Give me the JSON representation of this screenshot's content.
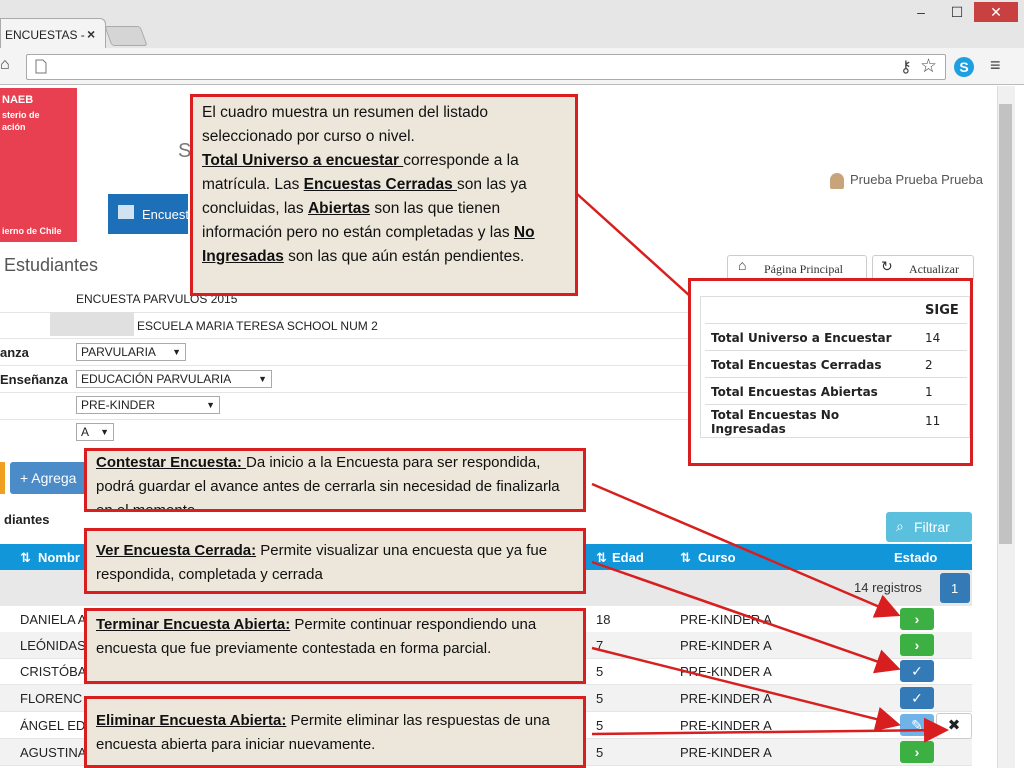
{
  "browser": {
    "tab_title": "ENCUESTAS -",
    "tab_close": "×",
    "window_controls": [
      "–",
      "☐",
      "✕"
    ]
  },
  "header": {
    "logo_lines": [
      "NAEB",
      "sterio de",
      "ación",
      "ierno de Chile"
    ],
    "partial_title": "S",
    "user_name": "Prueba Prueba Prueba",
    "menu_button": "Encuest"
  },
  "page": {
    "title": "Estudiantes",
    "btn_home": "Página Principal",
    "btn_refresh": "Actualizar"
  },
  "form": {
    "survey_name": "ENCUESTA PARVULOS 2015",
    "school_name": "ESCUELA MARIA TERESA SCHOOL NUM 2",
    "label_ensenanza": "anza",
    "label_tipo_ensenanza": "Enseñanza",
    "select_ensenanza": "PARVULARIA",
    "select_tipo": "EDUCACIÓN PARVULARIA",
    "select_grado": "PRE-KINDER",
    "select_letra": "A"
  },
  "actions": {
    "agregar": "+ Agrega",
    "estudiantes_label": "diantes",
    "filtrar": "Filtrar"
  },
  "summary": {
    "header": "SIGE",
    "rows": [
      {
        "label": "Total Universo a Encuestar",
        "value": "14"
      },
      {
        "label": "Total Encuestas Cerradas",
        "value": "2"
      },
      {
        "label": "Total Encuestas Abiertas",
        "value": "1"
      },
      {
        "label": "Total Encuestas No Ingresadas",
        "value": "11"
      }
    ]
  },
  "table": {
    "columns": {
      "nombre": "Nombr",
      "edad": "Edad",
      "curso": "Curso",
      "estado": "Estado"
    },
    "records_text": "14 registros",
    "page": "1",
    "rows": [
      {
        "nombre": "DANIELA A",
        "edad": "18",
        "curso": "PRE-KINDER A",
        "estado": "green"
      },
      {
        "nombre": "LEÓNIDAS",
        "edad": "7",
        "curso": "PRE-KINDER A",
        "estado": "green"
      },
      {
        "nombre": "CRISTÓBA",
        "edad": "5",
        "curso": "PRE-KINDER A",
        "estado": "blue"
      },
      {
        "nombre": "FLORENC",
        "edad": "5",
        "curso": "PRE-KINDER A",
        "estado": "blue"
      },
      {
        "nombre": "ÁNGEL ED",
        "edad": "5",
        "curso": "PRE-KINDER A",
        "estado": "lblue"
      },
      {
        "nombre": "AGUSTINA",
        "edad": "5",
        "curso": "PRE-KINDER A",
        "estado": "green"
      }
    ],
    "delete_icon": "✖"
  },
  "annotations": {
    "top": {
      "line1": "El cuadro muestra un resumen del listado seleccionado por curso o nivel.",
      "k1": "Total Universo a encuestar ",
      "t1": "corresponde a la matrícula. Las ",
      "k2": "Encuestas Cerradas ",
      "t2": "son las ya concluidas, las ",
      "k3": "Abiertas",
      "t3": " son las que tienen información pero no están completadas y las ",
      "k4": "No Ingresadas",
      "t4": " son las que aún están pendientes."
    },
    "contestar": {
      "key": "Contestar Encuesta: ",
      "text": " Da inicio a la Encuesta para ser respondida, podrá guardar el avance antes de cerrarla sin necesidad de finalizarla en el momento."
    },
    "ver": {
      "key": "Ver Encuesta Cerrada:",
      "text": " Permite visualizar una encuesta que ya fue respondida, completada y cerrada"
    },
    "terminar": {
      "key": "Terminar Encuesta Abierta:",
      "text": " Permite continuar respondiendo una encuesta que fue previamente contestada en forma parcial."
    },
    "eliminar": {
      "key": "Eliminar Encuesta Abierta:",
      "text": " Permite eliminar las respuestas de una  encuesta abierta para iniciar nuevamente."
    }
  },
  "colors": {
    "annotation_red": "#d81e1e",
    "header_blue": "#1196da",
    "green_btn": "#3cb043",
    "blue_btn": "#337ab7"
  }
}
